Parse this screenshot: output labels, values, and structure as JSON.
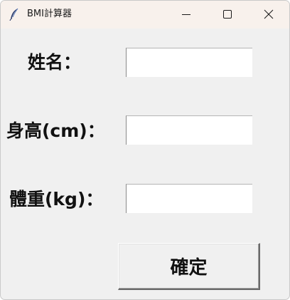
{
  "window": {
    "title": "BMI計算器",
    "app_icon": "feather-icon",
    "controls": {
      "minimize_icon": "minimize-icon",
      "maximize_icon": "maximize-icon",
      "close_icon": "close-icon"
    }
  },
  "form": {
    "name_label": "姓名：",
    "name_value": "",
    "height_label": "身高(cm)：",
    "height_value": "",
    "weight_label": "體重(kg)：",
    "weight_value": "",
    "submit_label": "確定"
  }
}
